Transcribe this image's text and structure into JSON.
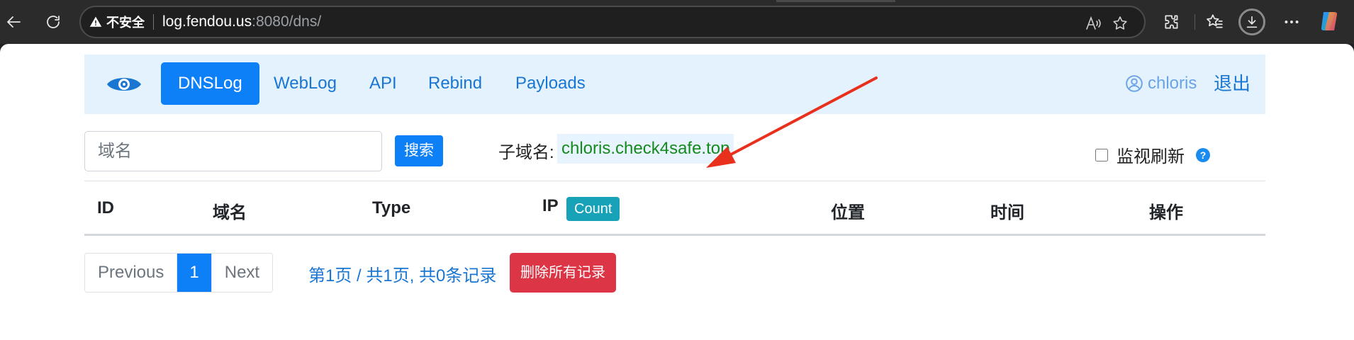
{
  "browser": {
    "security_label": "不安全",
    "url_host": "log.fendou.us",
    "url_rest": ":8080/dns/",
    "icons": [
      "back-icon",
      "refresh-icon",
      "warning-icon",
      "read-aloud-icon",
      "favorite-star-icon",
      "extensions-icon",
      "favorites-icon",
      "downloads-icon",
      "more-icon",
      "copilot-icon"
    ]
  },
  "navbar": {
    "brand_icon": "eye-icon",
    "items": [
      {
        "label": "DNSLog",
        "active": true
      },
      {
        "label": "WebLog",
        "active": false
      },
      {
        "label": "API",
        "active": false
      },
      {
        "label": "Rebind",
        "active": false
      },
      {
        "label": "Payloads",
        "active": false
      }
    ],
    "user": "chloris",
    "logout": "退出"
  },
  "search": {
    "placeholder": "域名",
    "value": "",
    "button": "搜索"
  },
  "subdomain": {
    "label": "子域名:",
    "value": "chloris.check4safe.top"
  },
  "monitor": {
    "label": "监视刷新",
    "checked": false,
    "help": "?"
  },
  "table": {
    "columns": [
      "ID",
      "域名",
      "Type",
      "IP",
      "位置",
      "时间",
      "操作"
    ],
    "count_badge": "Count",
    "rows": []
  },
  "pagination": {
    "previous": "Previous",
    "current": "1",
    "next": "Next",
    "info": "第1页 / 共1页, 共0条记录"
  },
  "actions": {
    "delete_all": "删除所有记录"
  },
  "colors": {
    "primary": "#0d7ff7",
    "navbar_bg": "#e3f2fd",
    "subdomain_text": "#178a1f",
    "danger": "#dc3545",
    "info_badge": "#17a2b8",
    "annotation_arrow": "#e8301c"
  }
}
